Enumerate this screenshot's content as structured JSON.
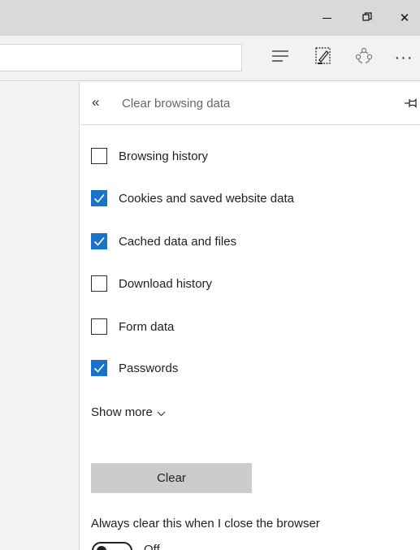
{
  "window": {
    "minimize_icon": "minimize-icon",
    "restore_icon": "restore-icon",
    "close_icon": "close-icon",
    "close_glyph": "✕"
  },
  "toolbar": {
    "address_value": "",
    "more_glyph": "···",
    "icons": [
      "hub-icon",
      "web-note-icon",
      "share-icon",
      "more-icon"
    ]
  },
  "panel": {
    "back_glyph": "«",
    "title": "Clear browsing data",
    "options": [
      {
        "label": "Browsing history",
        "checked": false
      },
      {
        "label": "Cookies and saved website data",
        "checked": true
      },
      {
        "label": "Cached data and files",
        "checked": true
      },
      {
        "label": "Download history",
        "checked": false
      },
      {
        "label": "Form data",
        "checked": false
      },
      {
        "label": "Passwords",
        "checked": true
      }
    ],
    "show_more": "Show more",
    "clear_button": "Clear",
    "always_clear_label": "Always clear this when I close the browser",
    "toggle_state": "Off",
    "toggle_on": false
  },
  "colors": {
    "accent": "#1a73c9",
    "titlebar": "#d9d9d9",
    "toolbar": "#f2f2f2",
    "button": "#cccccc"
  }
}
